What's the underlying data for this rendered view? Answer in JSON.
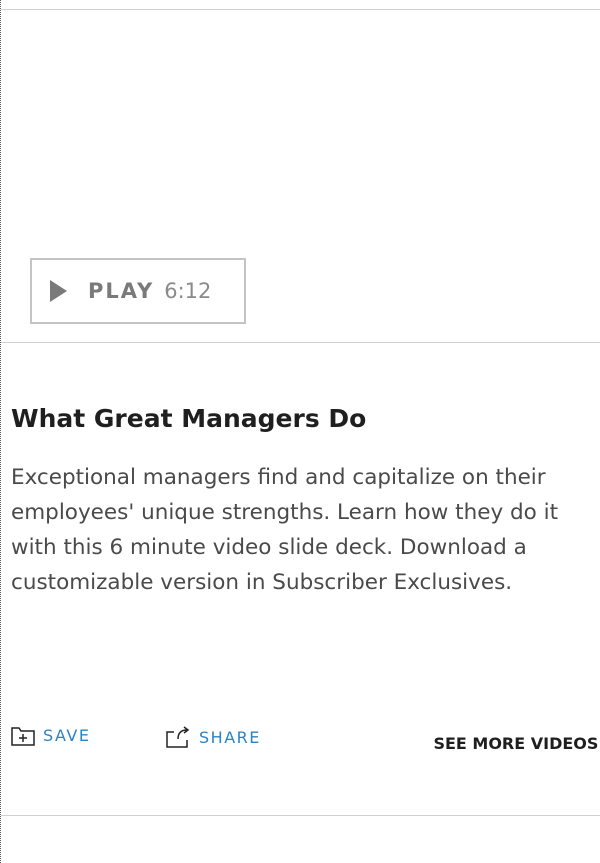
{
  "video": {
    "play_label": "PLAY",
    "duration": "6:12"
  },
  "article": {
    "title": "What Great Managers Do",
    "description": "Exceptional managers find and capitalize on their employees' unique strengths. Learn how they do it with this 6 minute video slide deck. Download a customizable version in Subscriber Exclusives."
  },
  "actions": {
    "save_label": "SAVE",
    "share_label": "SHARE",
    "see_more_label": "SEE MORE VIDEOS",
    "see_more_chevron": "›"
  },
  "icons": {
    "play": "play-icon",
    "save": "folder-plus-icon",
    "share": "share-arrow-icon",
    "see_more": "chevron-right-icon"
  },
  "colors": {
    "link_blue": "#2a83c6",
    "play_gray": "#7a7a7a",
    "border_gray": "#c4c4c4",
    "text_dark": "#1f1f1f",
    "text_body": "#4a4a4a"
  }
}
